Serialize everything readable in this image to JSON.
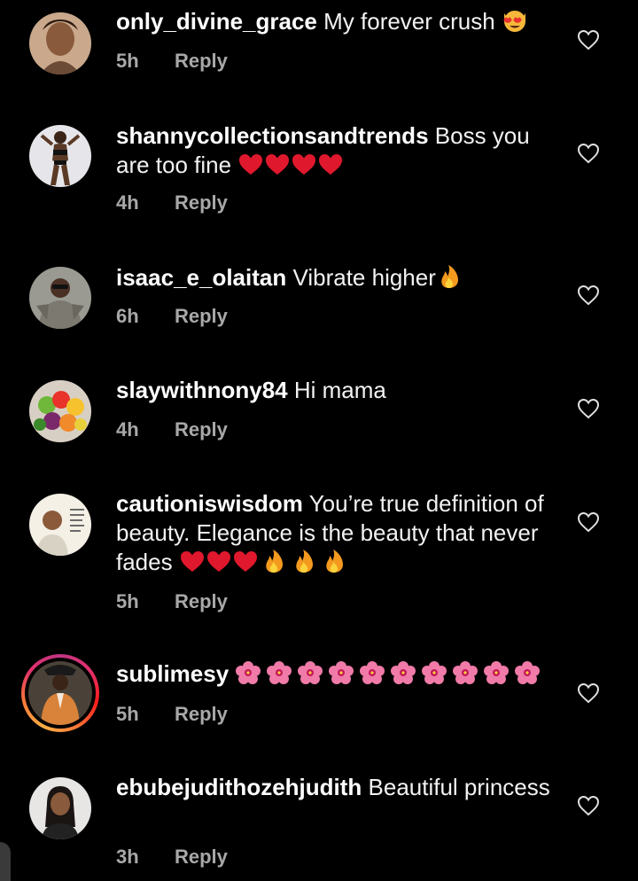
{
  "comments": [
    {
      "username": "only_divine_grace",
      "text": "My forever crush",
      "emoji": [
        "heart-eyes-cat"
      ],
      "time": "5h",
      "reply": "Reply"
    },
    {
      "username": "shannycollectionsandtrends",
      "text": "Boss you are too fine",
      "emoji": [
        "red-heart",
        "red-heart",
        "red-heart",
        "red-heart"
      ],
      "time": "4h",
      "reply": "Reply"
    },
    {
      "username": "isaac_e_olaitan",
      "text": "Vibrate higher",
      "emoji": [
        "fire"
      ],
      "time": "6h",
      "reply": "Reply"
    },
    {
      "username": "slaywithnony84",
      "text": "Hi mama",
      "emoji": [],
      "time": "4h",
      "reply": "Reply"
    },
    {
      "username": "cautioniswisdom",
      "text": "You’re true definition of beauty. Elegance is the beauty that never fades",
      "emoji": [
        "red-heart",
        "red-heart",
        "red-heart",
        "fire",
        "fire",
        "fire"
      ],
      "time": "5h",
      "reply": "Reply"
    },
    {
      "username": "sublimesy",
      "text": "",
      "emoji": [
        "hibiscus",
        "hibiscus",
        "hibiscus",
        "hibiscus",
        "hibiscus",
        "hibiscus",
        "hibiscus",
        "hibiscus",
        "hibiscus",
        "hibiscus"
      ],
      "time": "5h",
      "reply": "Reply"
    },
    {
      "username": "ebubejudithozehjudith",
      "text": "Beautiful princess",
      "emoji": [],
      "time": "3h",
      "reply": "Reply"
    }
  ],
  "colors": {
    "background": "#000000",
    "text": "#f2f2f2",
    "meta": "#a8a8a8",
    "heart_outline": "#e0e0e0"
  }
}
